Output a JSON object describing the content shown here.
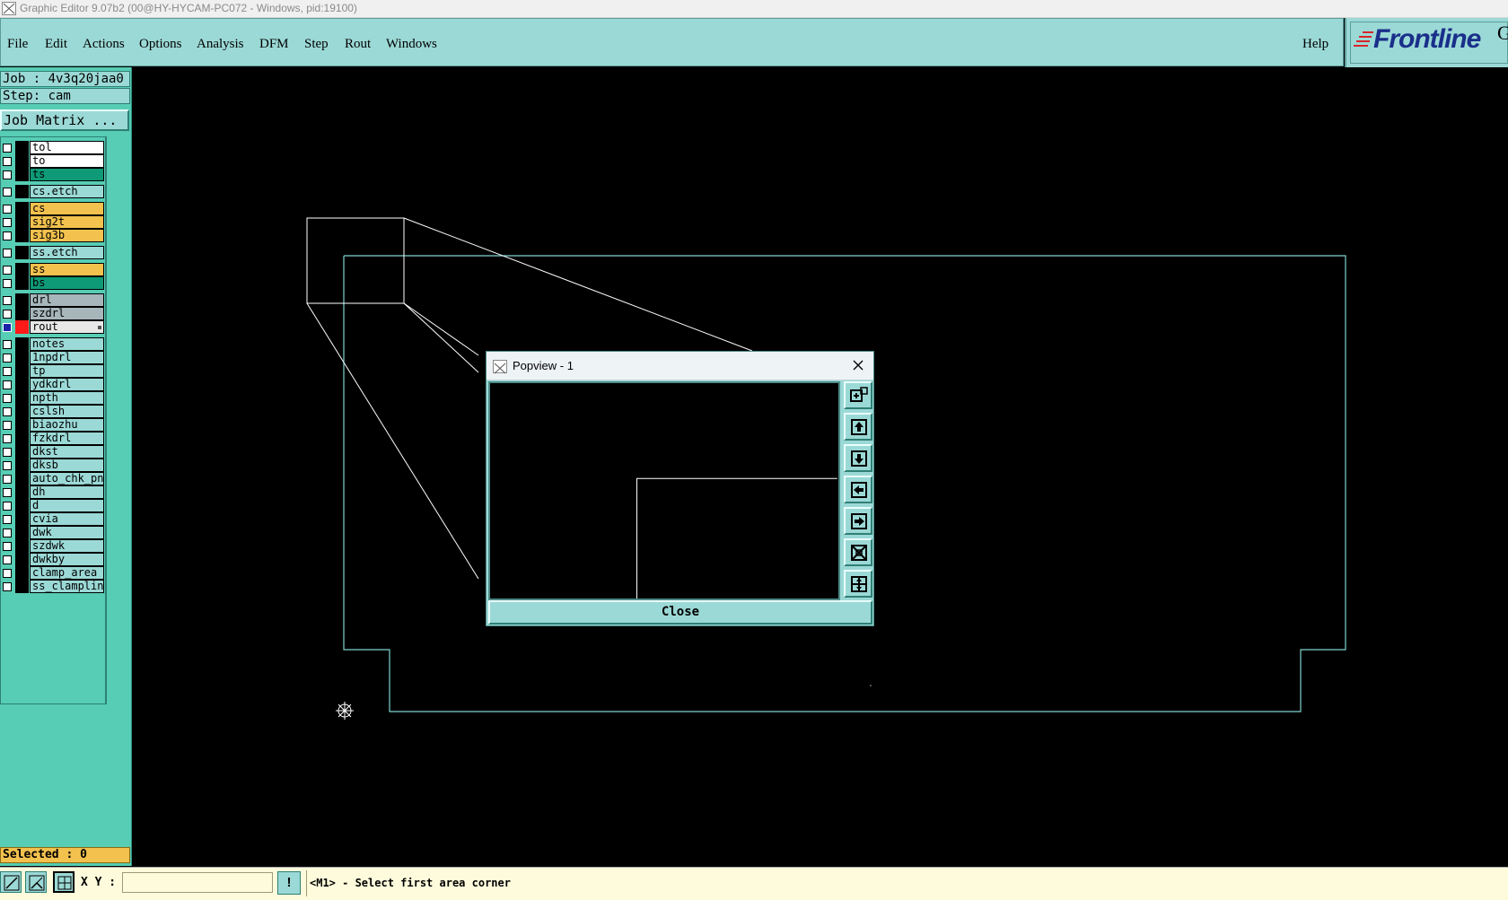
{
  "window": {
    "title": "Graphic Editor 9.07b2 (00@HY-HYCAM-PC072 - Windows, pid:19100)"
  },
  "menu": {
    "items": [
      "File",
      "Edit",
      "Actions",
      "Options",
      "Analysis",
      "DFM",
      "Step",
      "Rout",
      "Windows"
    ],
    "help": "Help"
  },
  "logo": {
    "text": "Frontline",
    "edge": "G"
  },
  "job": {
    "job_label": "Job : 4v3q20jaa0",
    "step_label": "Step: cam",
    "matrix_button": "Job Matrix ..."
  },
  "layers": [
    {
      "name": "tol",
      "color": "#ffffff"
    },
    {
      "name": "to",
      "color": "#ffffff"
    },
    {
      "name": "ts",
      "color": "#0e9a77"
    },
    {
      "name": "cs.etch",
      "color": "#9bd9d6"
    },
    {
      "name": "cs",
      "color": "#f2c14e"
    },
    {
      "name": "sig2t",
      "color": "#f2c14e"
    },
    {
      "name": "sig3b",
      "color": "#f2c14e"
    },
    {
      "name": "ss.etch",
      "color": "#9bd9d6"
    },
    {
      "name": "ss",
      "color": "#f2c14e"
    },
    {
      "name": "bs",
      "color": "#0e9a77"
    },
    {
      "name": "drl",
      "color": "#a7b6bb"
    },
    {
      "name": "szdrl",
      "color": "#a7b6bb"
    },
    {
      "name": "rout",
      "color": "#e8e8e8",
      "active": true
    },
    {
      "name": "notes",
      "color": "#9bd9d6"
    },
    {
      "name": "1npdrl",
      "color": "#9bd9d6"
    },
    {
      "name": "tp",
      "color": "#9bd9d6"
    },
    {
      "name": "ydkdrl",
      "color": "#9bd9d6"
    },
    {
      "name": "npth",
      "color": "#9bd9d6"
    },
    {
      "name": "cslsh",
      "color": "#9bd9d6"
    },
    {
      "name": "biaozhu",
      "color": "#9bd9d6"
    },
    {
      "name": "fzkdrl",
      "color": "#9bd9d6"
    },
    {
      "name": "dkst",
      "color": "#9bd9d6"
    },
    {
      "name": "dksb",
      "color": "#9bd9d6"
    },
    {
      "name": "auto_chk_pnl",
      "color": "#9bd9d6"
    },
    {
      "name": "dh",
      "color": "#9bd9d6"
    },
    {
      "name": "d",
      "color": "#9bd9d6"
    },
    {
      "name": "cvia",
      "color": "#9bd9d6"
    },
    {
      "name": "dwk",
      "color": "#9bd9d6"
    },
    {
      "name": "szdwk",
      "color": "#9bd9d6"
    },
    {
      "name": "dwkby",
      "color": "#9bd9d6"
    },
    {
      "name": "clamp_area",
      "color": "#9bd9d6"
    },
    {
      "name": "ss_clampline",
      "color": "#9bd9d6"
    }
  ],
  "selected": {
    "label": "Selected : 0"
  },
  "popview": {
    "title": "Popview - 1",
    "close_label": "Close"
  },
  "status": {
    "xy_label": "X Y :",
    "xy_value": "",
    "alert": "!",
    "message": "<M1> - Select first area corner"
  },
  "colors": {
    "panel": "#56cdb4",
    "menubar": "#9bd9d6",
    "outline": "#7fd3cf",
    "background": "#000000"
  }
}
